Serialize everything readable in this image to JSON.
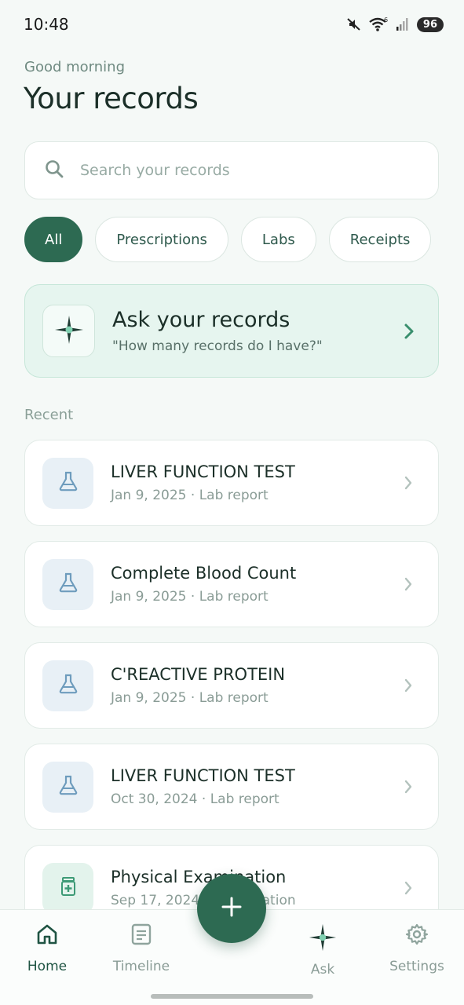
{
  "status_bar": {
    "time": "10:48",
    "wifi_superscript": "6",
    "battery": "96"
  },
  "header": {
    "greeting": "Good morning",
    "title": "Your records"
  },
  "search": {
    "placeholder": "Search your records"
  },
  "filters": [
    {
      "label": "All",
      "active": true
    },
    {
      "label": "Prescriptions",
      "active": false
    },
    {
      "label": "Labs",
      "active": false
    },
    {
      "label": "Receipts",
      "active": false
    }
  ],
  "ask_card": {
    "title": "Ask your records",
    "subtitle": "\"How many records do I have?\""
  },
  "recent": {
    "label": "Recent",
    "items": [
      {
        "title": "LIVER FUNCTION TEST",
        "meta": "Jan 9, 2025 · Lab report",
        "icon": "flask-icon"
      },
      {
        "title": "Complete Blood Count",
        "meta": "Jan 9, 2025 · Lab report",
        "icon": "flask-icon"
      },
      {
        "title": "C'REACTIVE PROTEIN",
        "meta": "Jan 9, 2025 · Lab report",
        "icon": "flask-icon"
      },
      {
        "title": "LIVER FUNCTION TEST",
        "meta": "Oct 30, 2024 · Lab report",
        "icon": "flask-icon"
      },
      {
        "title": "Physical Examination",
        "meta": "Sep 17, 2024 · Examination",
        "icon": "medicine-bottle-icon"
      }
    ]
  },
  "nav": {
    "home": "Home",
    "timeline": "Timeline",
    "ask": "Ask",
    "settings": "Settings"
  },
  "colors": {
    "accent": "#2d6a52",
    "background": "#f5f9f7",
    "ask_card_bg": "#e6f5ef"
  }
}
